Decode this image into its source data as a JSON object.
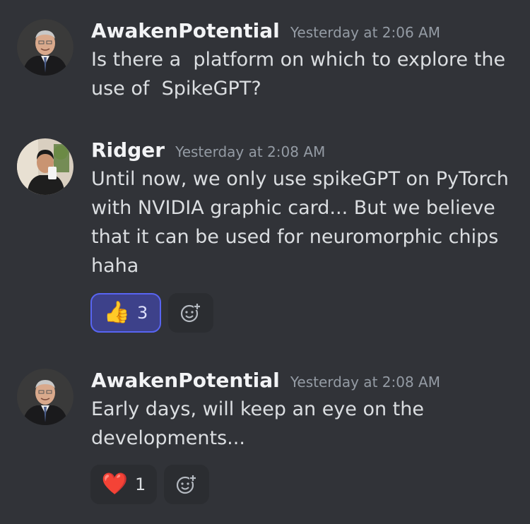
{
  "messages": [
    {
      "username": "AwakenPotential",
      "timestamp": "Yesterday at 2:06 AM",
      "text": "Is there a  platform on which to explore the use of  SpikeGPT?"
    },
    {
      "username": "Ridger",
      "timestamp": "Yesterday at 2:08 AM",
      "text": "Until now, we only use spikeGPT on PyTorch with NVIDIA graphic card... But we believe that it can be used for neuromorphic chips haha",
      "reactions": [
        {
          "emoji": "👍",
          "count": "3",
          "active": true
        }
      ]
    },
    {
      "username": "AwakenPotential",
      "timestamp": "Yesterday at 2:08 AM",
      "text": "Early days, will keep an eye on the developments...",
      "reactions": [
        {
          "emoji": "❤️",
          "count": "1",
          "active": false
        }
      ]
    }
  ],
  "colors": {
    "background": "#313338",
    "username": "#f2f3f5",
    "timestamp": "#949ba4",
    "text": "#dbdee1",
    "reaction_bg": "#2b2d31",
    "reaction_active_bg": "#3d418a",
    "reaction_active_border": "#5865f2"
  },
  "icons": {
    "add_reaction": "add-reaction-icon"
  }
}
